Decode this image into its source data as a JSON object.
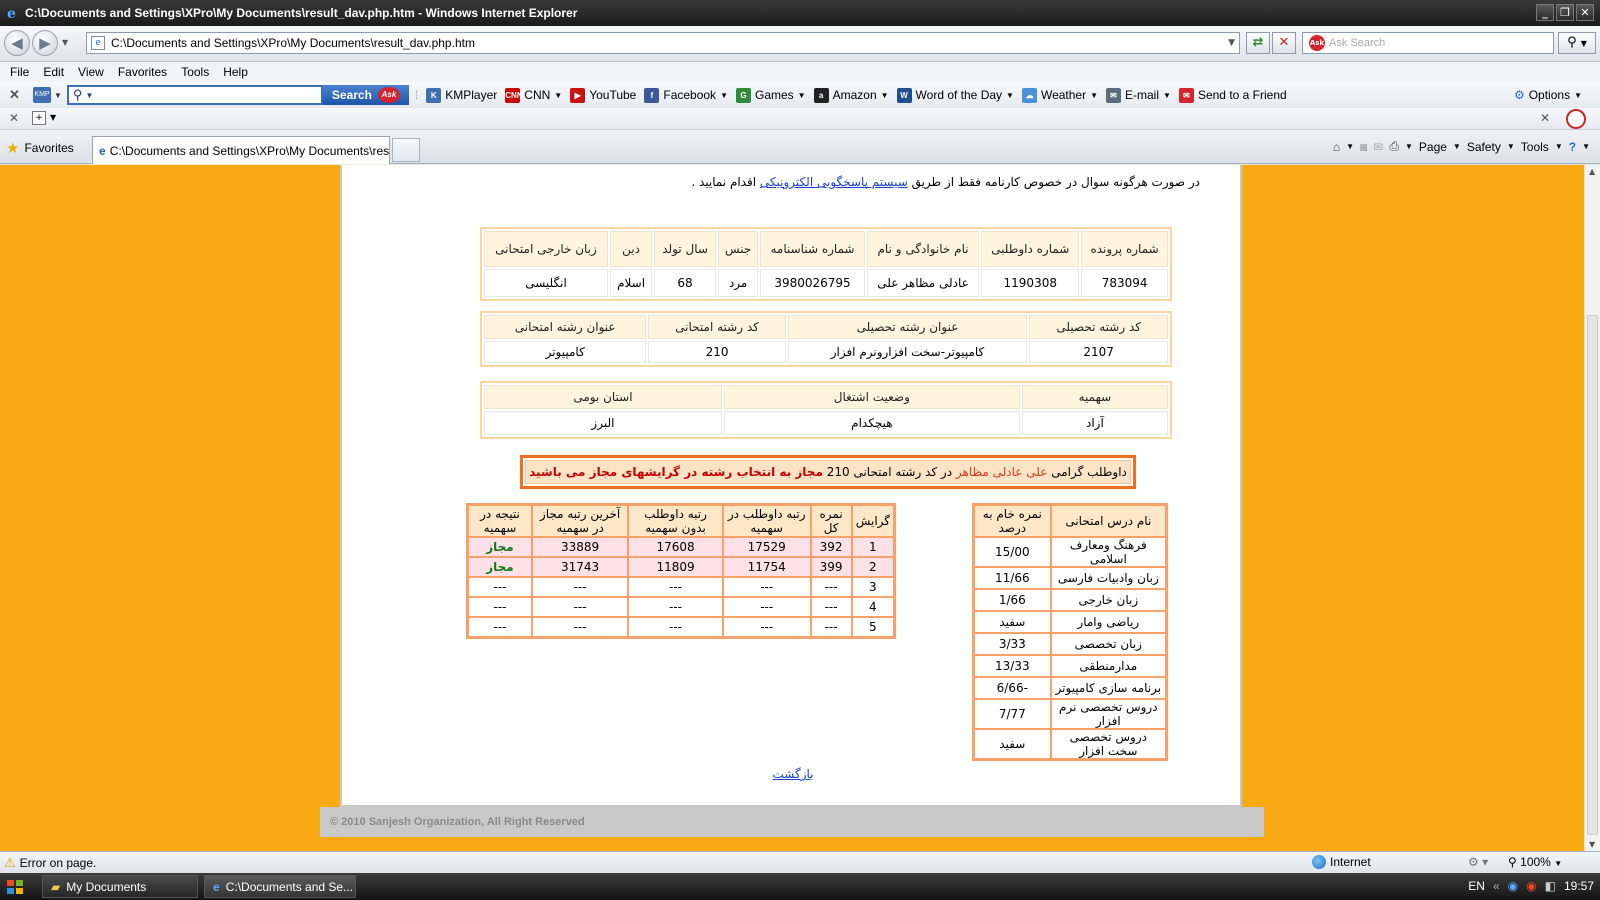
{
  "window": {
    "title": "C:\\Documents and Settings\\XPro\\My Documents\\result_dav.php.htm - Windows Internet Explorer",
    "address": "C:\\Documents and Settings\\XPro\\My Documents\\result_dav.php.htm",
    "search_placeholder": "Ask Search"
  },
  "menu": [
    "File",
    "Edit",
    "View",
    "Favorites",
    "Tools",
    "Help"
  ],
  "ask_toolbar": {
    "search_label": "Search",
    "search_brand": "Ask",
    "kmp": "KMP",
    "links": [
      {
        "label": "KMPlayer",
        "icon": "kmplayer-icon",
        "dropdown": false,
        "color": "#3f6fb1",
        "glyph": "K"
      },
      {
        "label": "CNN",
        "icon": "cnn-icon",
        "dropdown": true,
        "color": "#cc0000",
        "glyph": "CNN"
      },
      {
        "label": "YouTube",
        "icon": "youtube-icon",
        "dropdown": false,
        "color": "#cc1111",
        "glyph": "▶"
      },
      {
        "label": "Facebook",
        "icon": "facebook-icon",
        "dropdown": true,
        "color": "#3b5998",
        "glyph": "f"
      },
      {
        "label": "Games",
        "icon": "games-icon",
        "dropdown": true,
        "color": "#2e8b3c",
        "glyph": "G"
      },
      {
        "label": "Amazon",
        "icon": "amazon-icon",
        "dropdown": true,
        "color": "#222222",
        "glyph": "a"
      },
      {
        "label": "Word of the Day",
        "icon": "word-of-day-icon",
        "dropdown": true,
        "color": "#1f4f8c",
        "glyph": "W"
      },
      {
        "label": "Weather",
        "icon": "weather-icon",
        "dropdown": true,
        "color": "#4a90d9",
        "glyph": "☁"
      },
      {
        "label": "E-mail",
        "icon": "email-icon",
        "dropdown": true,
        "color": "#5c6b80",
        "glyph": "✉"
      },
      {
        "label": "Send to a Friend",
        "icon": "send-friend-icon",
        "dropdown": false,
        "color": "#d4242c",
        "glyph": "✉"
      }
    ],
    "options_label": "Options"
  },
  "tabs": {
    "favorites_label": "Favorites",
    "active_tab": "C:\\Documents and Settings\\XPro\\My Documents\\resul...",
    "cmd": [
      "Page",
      "Safety",
      "Tools"
    ]
  },
  "page": {
    "note_before": "در صورت هرگونه سوال در خصوص کارنامه فقط از طریق ",
    "note_link": "سیستم پاسخگویی الکترونیکی",
    "note_after": " اقدام نمایید .",
    "info": {
      "headers": [
        "شماره پرونده",
        "شماره داوطلبی",
        "نام خانوادگی و نام",
        "شماره شناسنامه",
        "جنس",
        "سال تولد",
        "دین",
        "زبان خارجی امتحانی"
      ],
      "values": [
        "783094",
        "1190308",
        "عادلی مظاهر علی",
        "3980026795",
        "مرد",
        "68",
        "اسلام",
        "انگلیسی"
      ]
    },
    "field": {
      "headers": [
        "کد رشته تحصیلی",
        "عنوان رشته تحصیلی",
        "کد رشته امتحانی",
        "عنوان رشته امتحانی"
      ],
      "values": [
        "2107",
        "کامپیوتر-سخت افزارونرم افزار",
        "210",
        "کامپیوتر"
      ]
    },
    "quota": {
      "headers": [
        "سهمیه",
        "وضعیت اشتغال",
        "استان بومی"
      ],
      "values": [
        "آزاد",
        "هیچکدام",
        "البرز"
      ]
    },
    "banner": {
      "prefix": "داوطلب گرامی",
      "name": "علی عادلی مظاهر",
      "middle": "در کد رشته امتحانی 210",
      "result": "مجاز به انتخاب رشته در گرایشهای مجاز می باشید"
    },
    "subjects": {
      "headers": [
        "نام درس امتحانی",
        "نمره خام به درصد"
      ],
      "rows": [
        [
          "فرهنگ ومعارف اسلامی",
          "15/00"
        ],
        [
          "زبان وادبیات فارسی",
          "11/66"
        ],
        [
          "زبان خارجی",
          "1/66"
        ],
        [
          "ریاضی وامار",
          "سفید"
        ],
        [
          "زبان تخصصی",
          "3/33"
        ],
        [
          "مدارمنطقی",
          "13/33"
        ],
        [
          "برنامه سازی کامپیوتر",
          "-6/66"
        ],
        [
          "دروس تخصصی نرم افزار",
          "7/77"
        ],
        [
          "دروس تخصصی سخت افزار",
          "سفید"
        ]
      ]
    },
    "groups": {
      "headers": [
        "گرایش",
        "نمره کل",
        "رتبه داوطلب در سهمیه",
        "رتبه داوطلب بدون سهمیه",
        "آخرین رتبه مجاز در سهمیه",
        "نتیجه در سهمیه"
      ],
      "rows": [
        [
          "1",
          "392",
          "17529",
          "17608",
          "33889",
          "مجاز"
        ],
        [
          "2",
          "399",
          "11754",
          "11809",
          "31743",
          "مجاز"
        ],
        [
          "3",
          "---",
          "---",
          "---",
          "---",
          "---"
        ],
        [
          "4",
          "---",
          "---",
          "---",
          "---",
          "---"
        ],
        [
          "5",
          "---",
          "---",
          "---",
          "---",
          "---"
        ]
      ]
    },
    "back_link": "بازگشت",
    "footer": "© 2010 Sanjesh Organization, All Right Reserved"
  },
  "status": {
    "error": "Error on page.",
    "zone": "Internet",
    "zoom": "100%"
  },
  "taskbar": {
    "items": [
      "My Documents",
      "C:\\Documents and Se..."
    ],
    "lang": "EN",
    "time": "19:57"
  }
}
